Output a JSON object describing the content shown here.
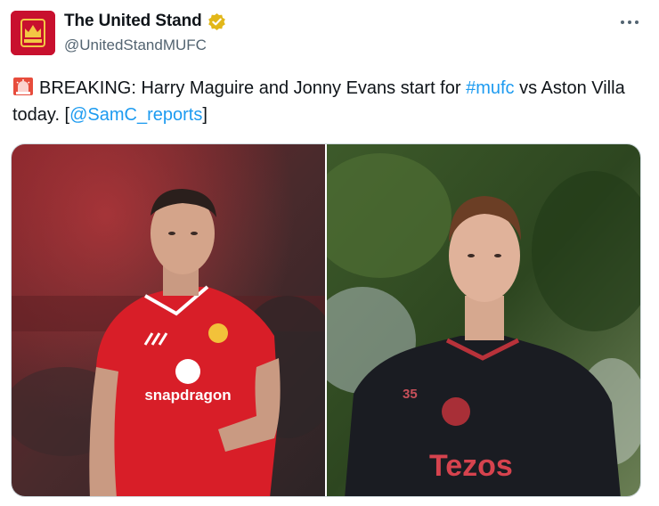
{
  "account": {
    "display_name": "The United Stand",
    "handle": "@UnitedStandMUFC",
    "verified": true
  },
  "tweet": {
    "emoji": "siren-icon",
    "text_before_hashtag": "BREAKING: Harry Maguire and Jonny Evans start for ",
    "hashtag": "#mufc",
    "text_after_hashtag": " vs Aston Villa today. [",
    "mention": "@SamC_reports",
    "text_end": "]"
  },
  "media": {
    "photo_left": {
      "description_icon": "player-photo-red-kit",
      "sponsor": "snapdragon"
    },
    "photo_right": {
      "description_icon": "player-photo-training-kit",
      "number": "35",
      "sponsor": "Tezos"
    }
  },
  "colors": {
    "link": "#1d9bf0",
    "verified_badge": "#e2b719",
    "home_kit_red": "#d81e28",
    "training_kit_dark": "#1a1c22"
  }
}
